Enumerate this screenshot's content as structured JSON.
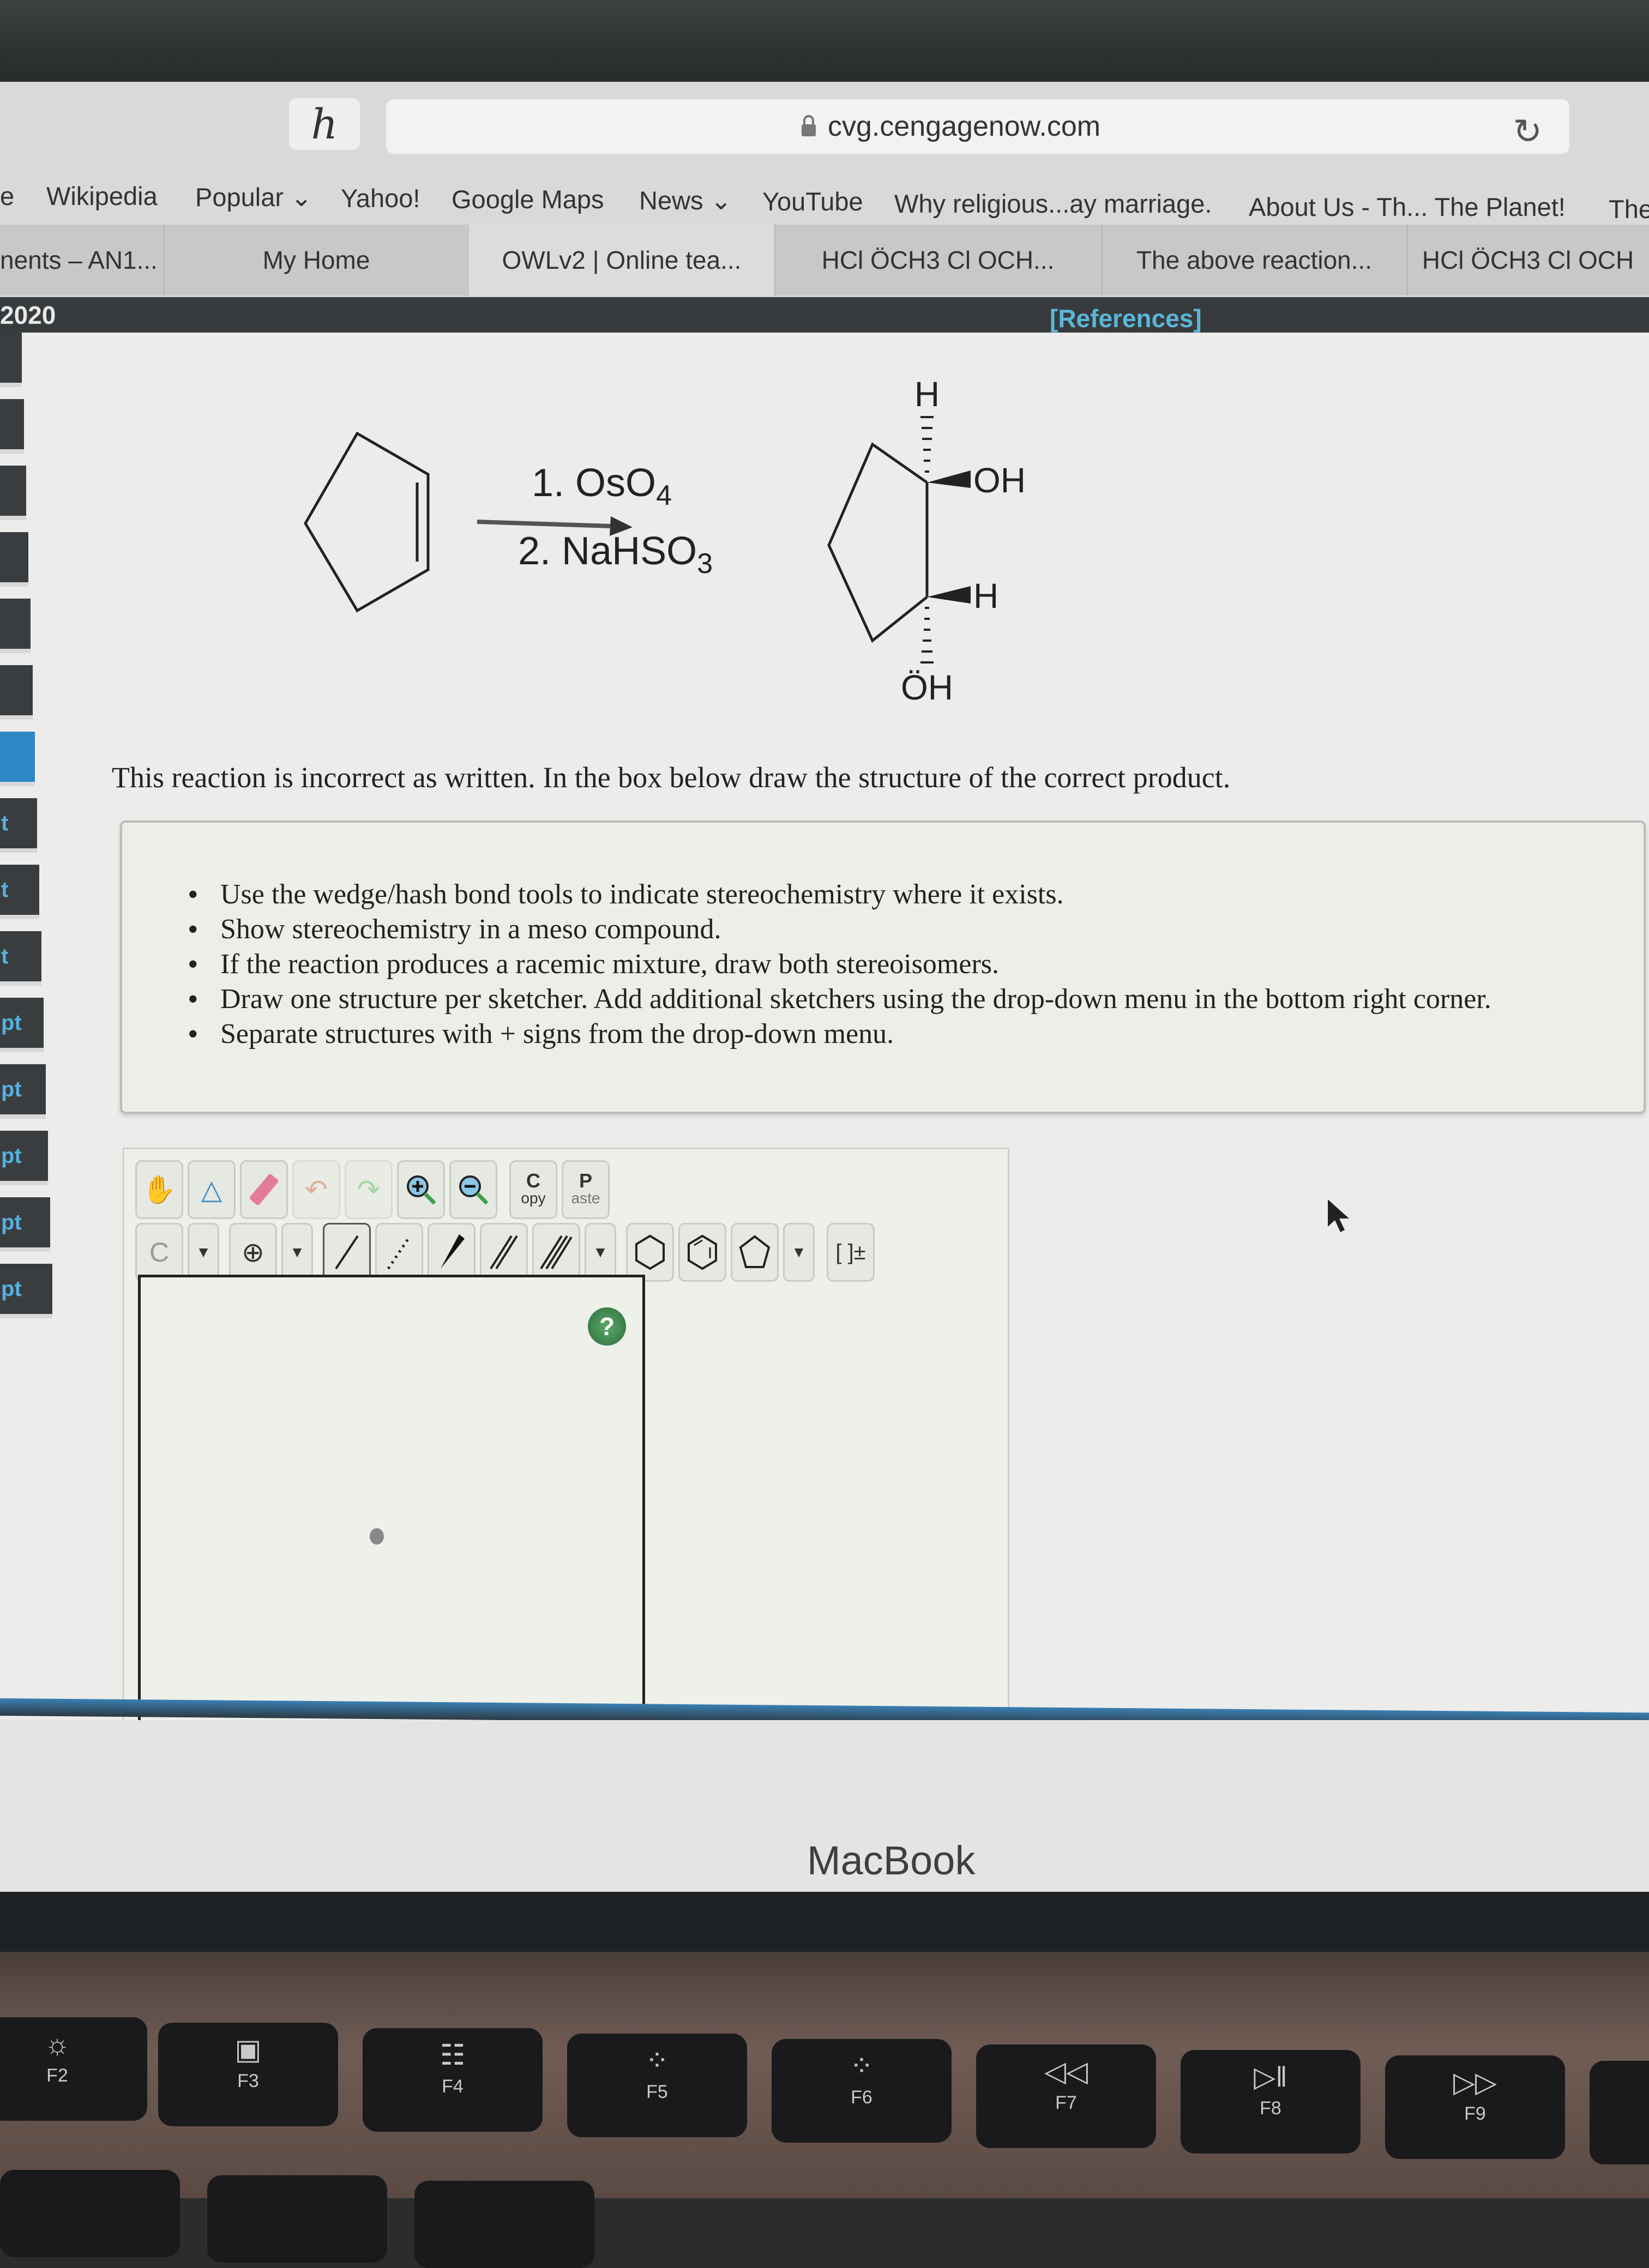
{
  "browser": {
    "url": "cvg.cengagenow.com",
    "home_icon": "h",
    "bookmarks": [
      "e",
      "Wikipedia",
      "Popular ⌄",
      "Yahoo!",
      "Google Maps",
      "News ⌄",
      "YouTube",
      "Why religious...ay marriage.",
      "About Us - Th... The Planet!",
      "The"
    ],
    "tabs": [
      {
        "label": "nents – AN1...",
        "active": false
      },
      {
        "label": "My Home",
        "active": false
      },
      {
        "label": "OWLv2 | Online tea...",
        "active": true
      },
      {
        "label": "HCl ÖCH3 Cl OCH...",
        "active": false
      },
      {
        "label": "The above reaction...",
        "active": false
      },
      {
        "label": "HCl ÖCH3 Cl OCH",
        "active": false
      }
    ]
  },
  "page": {
    "year_label": "2020",
    "references_link": "[References]",
    "sidebar_items": [
      "",
      "",
      "",
      "",
      "",
      "",
      "",
      "t",
      "t",
      "t",
      "pt",
      "pt",
      "pt",
      "pt",
      "pt"
    ],
    "sidebar_active_index": 6
  },
  "reaction": {
    "reagent_1": "1. OsO",
    "reagent_1_sub": "4",
    "reagent_2": "2. NaHSO",
    "reagent_2_sub": "3",
    "product_labels": {
      "top_h": "H",
      "oh_right": "OH",
      "h_right": "H",
      "oh_bottom": "ÖH"
    }
  },
  "question": {
    "prompt": "This reaction is incorrect as written. In the box below draw the structure of the correct product.",
    "instructions": [
      "Use the wedge/hash bond tools to indicate stereochemistry where it exists.",
      "Show stereochemistry in a meso compound.",
      "If the reaction produces a racemic mixture, draw both stereoisomers.",
      "Draw one structure per sketcher. Add additional sketchers using the drop-down menu in the bottom right corner.",
      "Separate structures with + signs from the drop-down menu."
    ]
  },
  "sketcher": {
    "copy_label_top": "C",
    "copy_label_bottom": "opy",
    "paste_label_top": "P",
    "paste_label_bottom": "aste",
    "atom_label": "C",
    "charge_symbol": "⊕",
    "bracket_label": "[ ]±",
    "help_label": "?"
  },
  "laptop": {
    "brand": "MacBook",
    "fkeys": [
      {
        "symbol": "☼",
        "label": "F2"
      },
      {
        "symbol": "▣",
        "label": "F3"
      },
      {
        "symbol": "☷",
        "label": "F4"
      },
      {
        "symbol": "⁘",
        "label": "F5"
      },
      {
        "symbol": "⁘",
        "label": "F6"
      },
      {
        "symbol": "◁◁",
        "label": "F7"
      },
      {
        "symbol": "▷‖",
        "label": "F8"
      },
      {
        "symbol": "▷▷",
        "label": "F9"
      }
    ]
  }
}
